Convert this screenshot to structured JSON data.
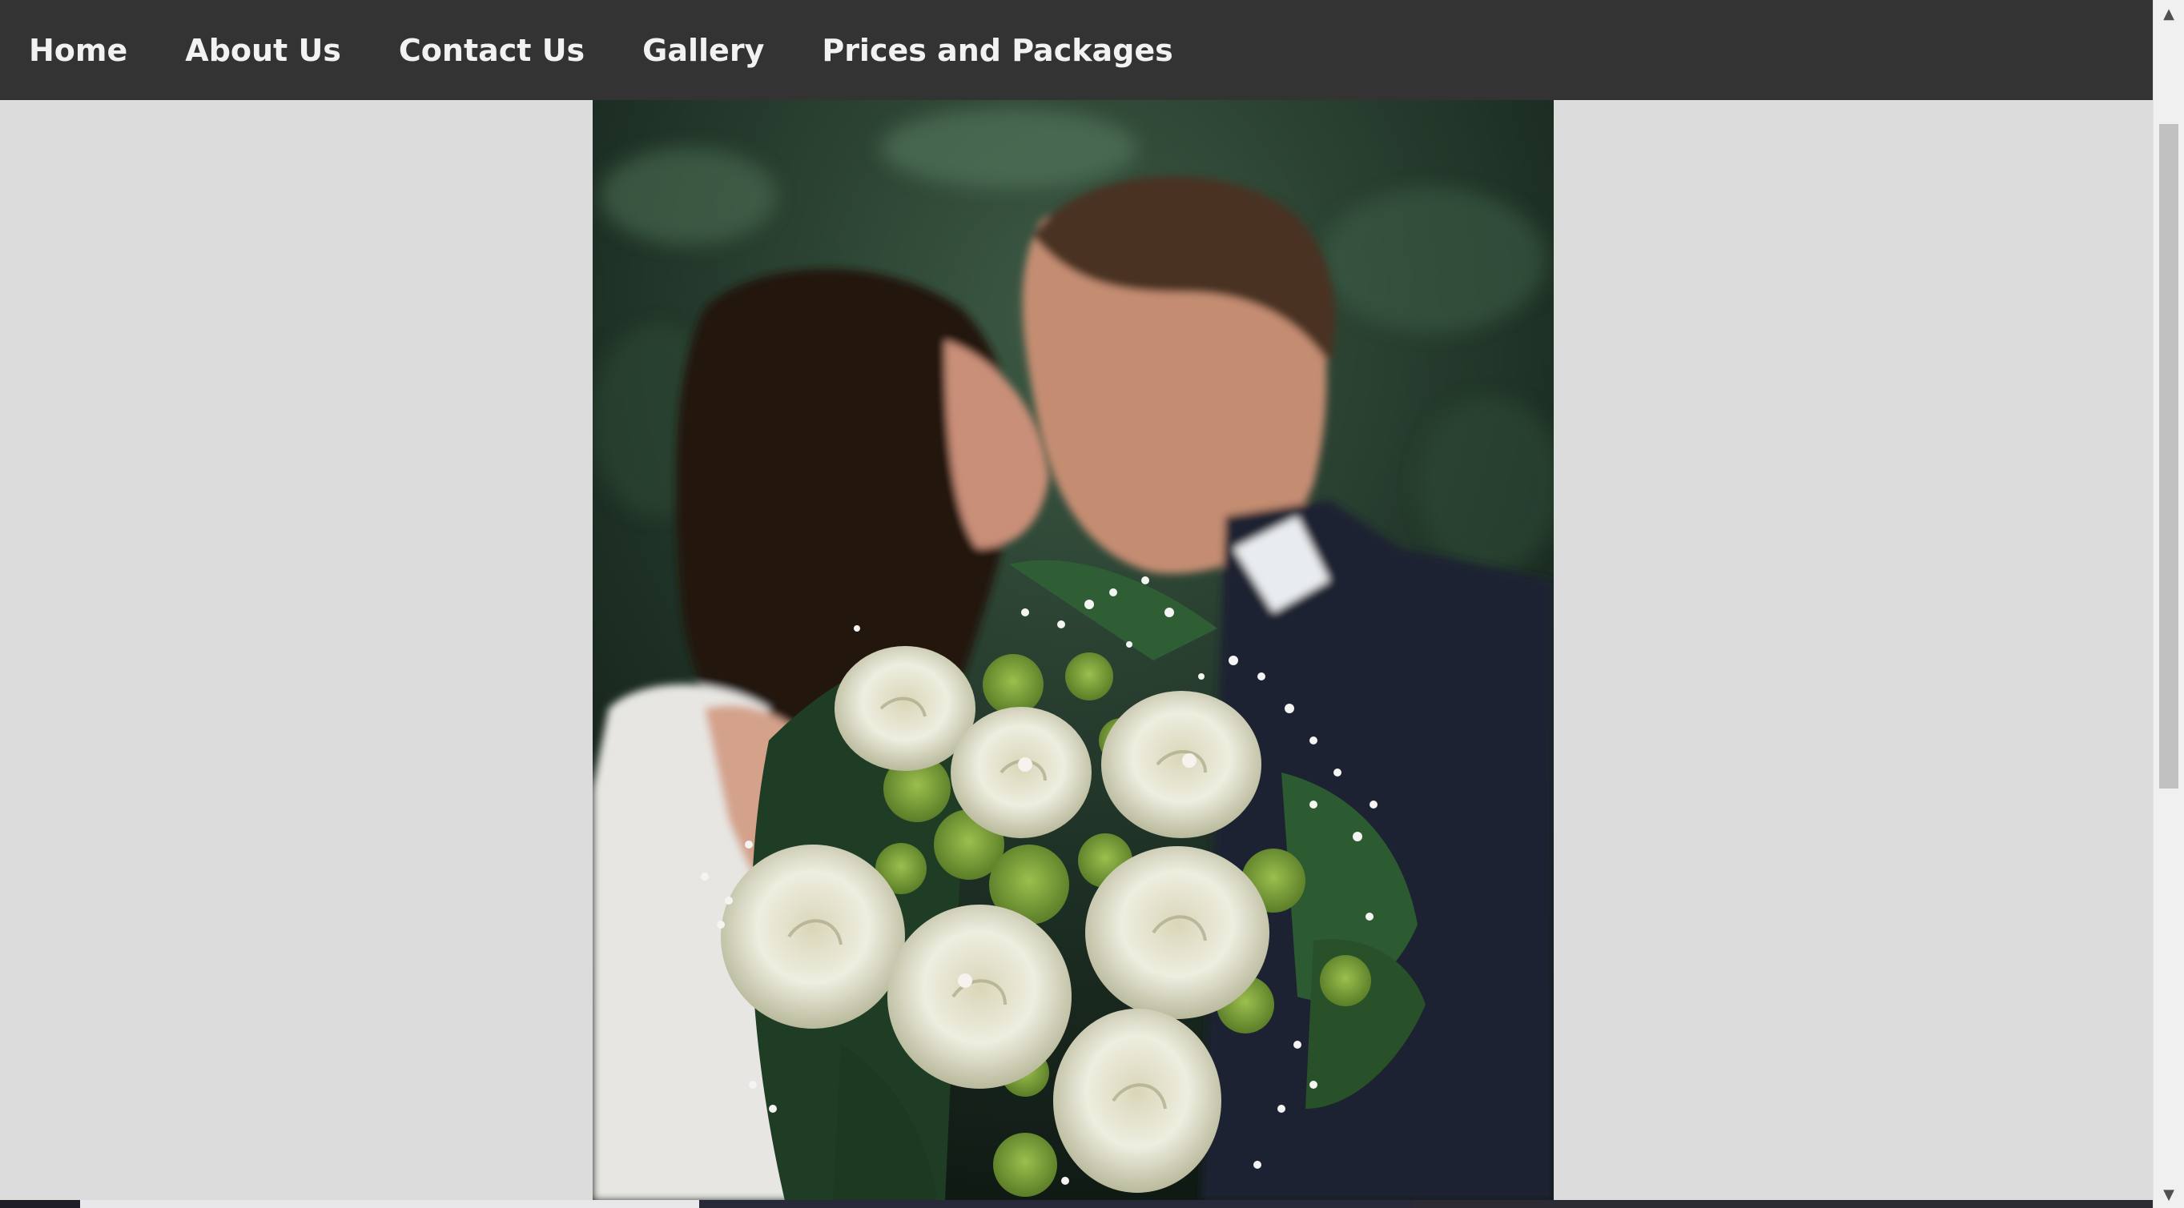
{
  "nav": {
    "items": [
      {
        "label": "Home"
      },
      {
        "label": "About Us"
      },
      {
        "label": "Contact Us"
      },
      {
        "label": "Gallery"
      },
      {
        "label": "Prices and Packages"
      }
    ]
  },
  "colors": {
    "navbar": "#333333",
    "nav_text": "#f2f2f2",
    "page_background": "#dcdcdc",
    "scrollbar_track": "#f0f0f0",
    "scrollbar_thumb": "#c1c1c1"
  },
  "icons": {
    "scroll_up": "triangle-up-icon",
    "scroll_down": "triangle-down-icon"
  }
}
